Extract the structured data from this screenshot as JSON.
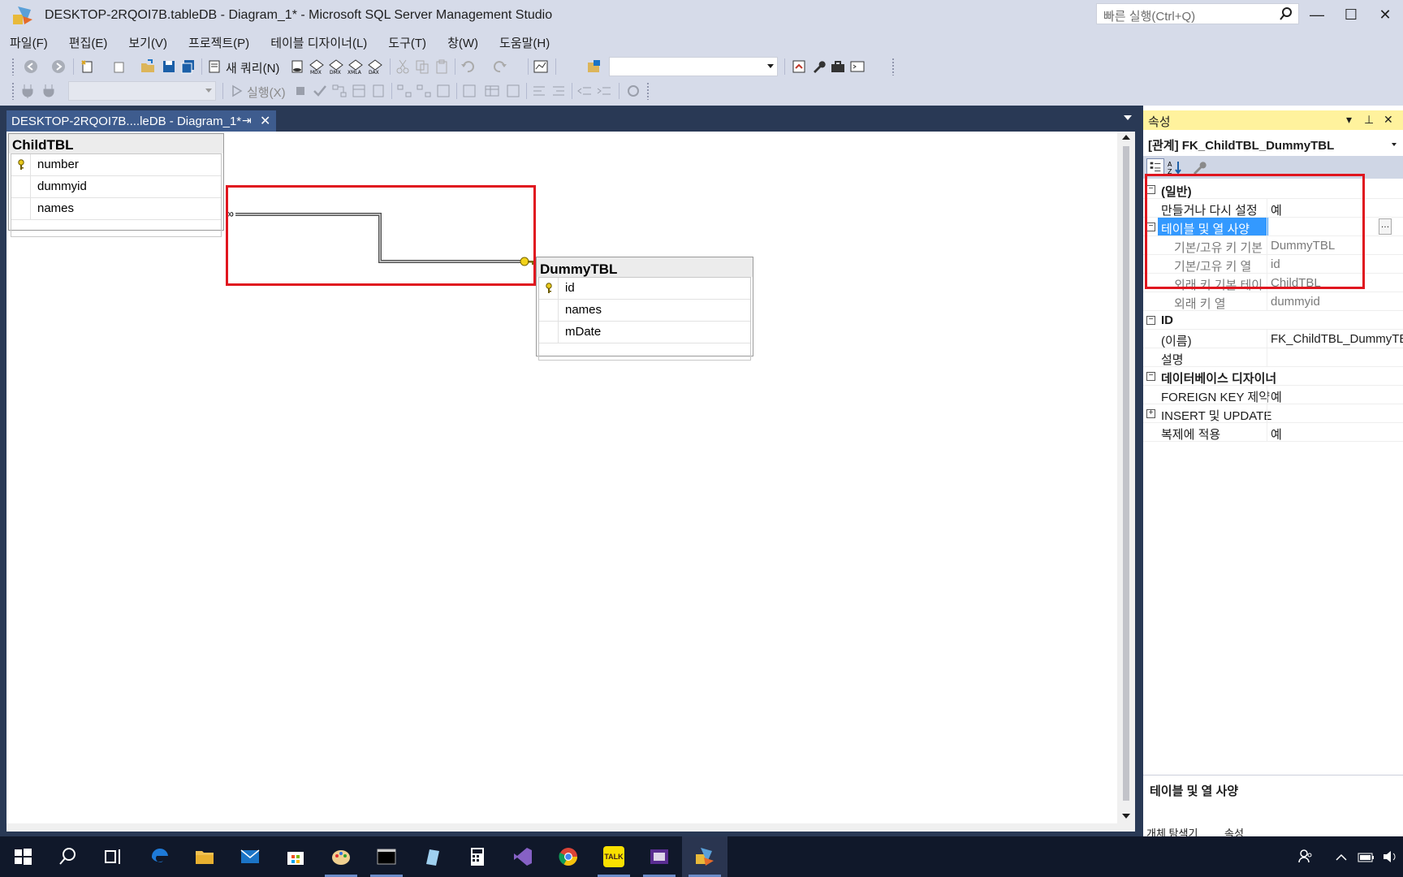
{
  "window": {
    "title": "DESKTOP-2RQOI7B.tableDB - Diagram_1* - Microsoft SQL Server Management Studio",
    "quick_launch_placeholder": "빠른 실행(Ctrl+Q)",
    "minimize": "—",
    "maximize": "☐",
    "close": "✕"
  },
  "menu": [
    "파일(F)",
    "편집(E)",
    "보기(V)",
    "프로젝트(P)",
    "테이블 디자이너(L)",
    "도구(T)",
    "창(W)",
    "도움말(H)"
  ],
  "toolbar": {
    "new_query_label": "새 쿼리(N)",
    "execute_label": "실행(X)",
    "db_combo_value": "",
    "solution_combo_value": ""
  },
  "document": {
    "tab_label": "DESKTOP-2RQOI7B....leDB - Diagram_1*",
    "pin": "⇥",
    "close": "✕"
  },
  "diagram": {
    "child_table": {
      "name": "ChildTBL",
      "columns": [
        {
          "name": "number",
          "key": true
        },
        {
          "name": "dummyid",
          "key": false
        },
        {
          "name": "names",
          "key": false
        }
      ]
    },
    "parent_table": {
      "name": "DummyTBL",
      "columns": [
        {
          "name": "id",
          "key": true
        },
        {
          "name": "names",
          "key": false
        },
        {
          "name": "mDate",
          "key": false
        }
      ]
    },
    "relationship_end_many": "∞"
  },
  "properties": {
    "title": "속성",
    "object": "[관계] FK_ChildTBL_DummyTBL",
    "rows": [
      {
        "type": "cat",
        "name": "(일반)"
      },
      {
        "type": "prop",
        "name": "만들거나 다시 설정",
        "value": "예"
      },
      {
        "type": "selexp",
        "name": "테이블 및 열 사양",
        "value": ""
      },
      {
        "type": "sub",
        "name": "기본/고유 키 기본",
        "value": "DummyTBL"
      },
      {
        "type": "sub",
        "name": "기본/고유 키 열",
        "value": "id"
      },
      {
        "type": "sub",
        "name": "외래 키 기본 테이",
        "value": "ChildTBL"
      },
      {
        "type": "sub",
        "name": "외래 키 열",
        "value": "dummyid"
      },
      {
        "type": "cat",
        "name": "ID"
      },
      {
        "type": "prop",
        "name": "(이름)",
        "value": "FK_ChildTBL_DummyTBL"
      },
      {
        "type": "prop",
        "name": "설명",
        "value": ""
      },
      {
        "type": "cat",
        "name": "데이터베이스 디자이너"
      },
      {
        "type": "prop",
        "name": "FOREIGN KEY 제약",
        "value": "예"
      },
      {
        "type": "expprop",
        "name": "INSERT 및 UPDATE",
        "value": ""
      },
      {
        "type": "prop",
        "name": "복제에 적용",
        "value": "예"
      }
    ],
    "description": "테이블 및 열 사양",
    "bottom_tabs": [
      "개체 탐색기",
      "속성"
    ]
  },
  "taskbar": {
    "apps": [
      "start-icon",
      "search-icon",
      "task-view-icon",
      "edge-icon",
      "file-explorer-icon",
      "mail-icon",
      "store-icon",
      "paint-icon",
      "terminal-icon",
      "notes-icon",
      "calculator-icon",
      "visual-studio-icon",
      "chrome-icon",
      "kakaotalk-icon",
      "media-icon",
      "ssms-icon"
    ],
    "kakao_label": "TALK"
  },
  "colors": {
    "accent_highlight": "#e0161f",
    "tab_active": "#3e5c8e",
    "props_header": "#fff29d",
    "selection": "#3399ff"
  }
}
